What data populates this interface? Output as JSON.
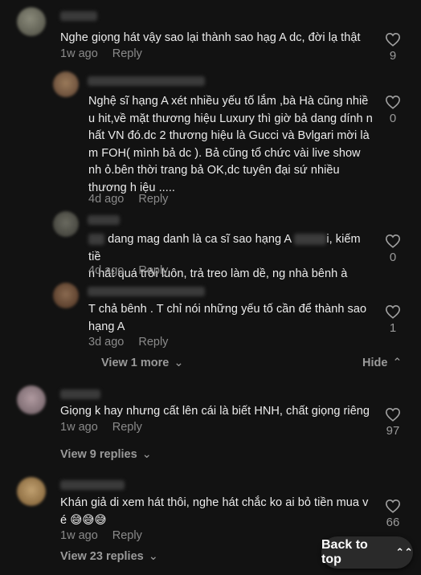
{
  "comments": [
    {
      "text": "Nghe giọng hát vậy sao lại thành sao hạg A dc, đời lạ thật",
      "time": "1w ago",
      "reply": "Reply",
      "likes": "9"
    },
    {
      "text": "Nghệ sĩ hạng A xét nhiều yếu tố lắm ,bà Hà cũng nhiề u hit,về mặt thương hiệu Luxury thì giờ bả dang dính n hất VN đó.dc 2 thương hiệu là Gucci và Bvlgari mời là m FOH( mình bả dc ). Bả cũng tổ chức vài live show nh ỏ.bên thời trang bả OK,dc tuyên đại sứ nhiều thương h iệu .....",
      "time": "4d ago",
      "reply": "Reply",
      "likes": "0"
    },
    {
      "text_a": "dang mag danh là ca sĩ sao hạng A",
      "text_b": "i, kiếm tiề",
      "text_c": "n hát quá trời luôn, trả treo làm dề, ng nhà bênh à",
      "time": "4d ago",
      "reply": "Reply",
      "likes": "0"
    },
    {
      "text": "T chả bênh . T chỉ nói những yếu tố cần để thành sao hạng A",
      "time": "3d ago",
      "reply": "Reply",
      "likes": "1"
    },
    {
      "text": "Giọng k hay nhưng cất lên cái là biết HNH, chất giọng riêng",
      "time": "1w ago",
      "reply": "Reply",
      "likes": "97"
    },
    {
      "text": "Khán giả di xem hát thôi, nghe hát chắc ko ai bỏ tiền mua v é 😅😅😅",
      "time": "1w ago",
      "reply": "Reply",
      "likes": "66"
    }
  ],
  "view_1_more": "View 1 more",
  "hide": "Hide",
  "view_9_replies": "View 9 replies",
  "view_23_replies": "View 23 replies",
  "back_to_top": "Back to top",
  "icons": {
    "like": "heart-outline-icon",
    "chevron_down": "chevron-down-icon",
    "chevron_up": "chevron-up-icon",
    "double_chevron_up": "double-chevron-up-icon"
  }
}
